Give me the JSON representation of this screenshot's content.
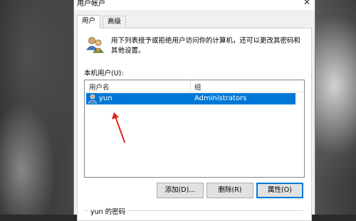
{
  "window": {
    "title": "用户帐户",
    "close_glyph": "✕"
  },
  "tabs": [
    {
      "label": "用户",
      "active": true
    },
    {
      "label": "高级",
      "active": false
    }
  ],
  "description": "用下列表授予或拒绝用户访问你的计算机，还可以更改其密码和其他设置。",
  "list": {
    "label": "本机用户(U):",
    "columns": [
      "用户名",
      "组"
    ],
    "rows": [
      {
        "name": "yun",
        "group": "Administrators",
        "selected": true
      }
    ]
  },
  "buttons": {
    "add": "添加(D)...",
    "delete": "删除(R)",
    "properties": "属性(O)"
  },
  "password_section": {
    "label": "yun 的密码"
  },
  "colors": {
    "selection": "#0078d7",
    "annotation_arrow": "#e0261b"
  },
  "icons": {
    "users": "users-icon",
    "user_row": "user-icon",
    "close": "close-icon"
  }
}
